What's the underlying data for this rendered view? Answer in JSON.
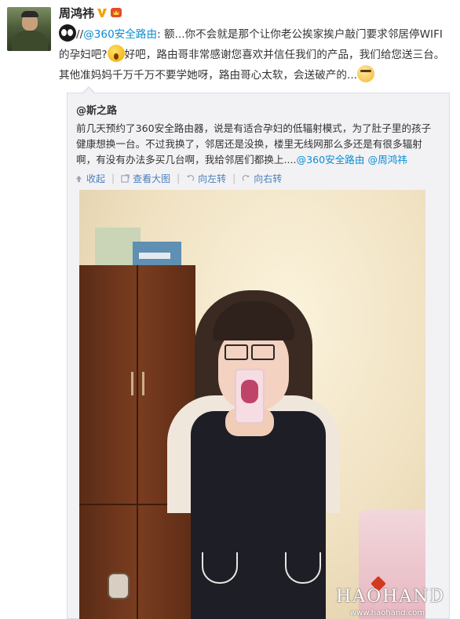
{
  "post": {
    "author": "周鸿祎",
    "badges": [
      "verified-v-icon",
      "member-icon"
    ],
    "text_prefix": "//",
    "mention_router": "@360安全路由",
    "text_part1": ": 额...你不会就是那个让你老公挨家挨户敲门要求邻居停WIFI的孕妇吧?",
    "text_part2": "好吧，路由哥非常感谢您喜欢并信任我们的产品，我们给您送三台。其他准妈妈千万千万不要学她呀，路由哥心太软，会送破产的...",
    "emojis": [
      "eyes-icon",
      "surprised-icon",
      "sweat-icon"
    ]
  },
  "quote": {
    "author": "@斯之路",
    "text": "前几天预约了360安全路由器，说是有适合孕妇的低辐射模式，为了肚子里的孩子健康想换一台。不过我换了，邻居还是没换，楼里无线网那么多还是有很多辐射啊，有没有办法多买几台啊，我给邻居们都换上....",
    "mention1": "@360安全路由",
    "mention2": "@周鸿祎",
    "actions": [
      {
        "label": "收起",
        "icon": "collapse-icon"
      },
      {
        "label": "查看大图",
        "icon": "view-large-icon"
      },
      {
        "label": "向左转",
        "icon": "rotate-left-icon"
      },
      {
        "label": "向右转",
        "icon": "rotate-right-icon"
      }
    ]
  },
  "watermark": {
    "brand": "HAOHAND",
    "url": "www.haohand.com"
  },
  "colors": {
    "link": "#0a8cd2",
    "action": "#4c7fb8",
    "quote_bg": "#f2f2f5"
  }
}
